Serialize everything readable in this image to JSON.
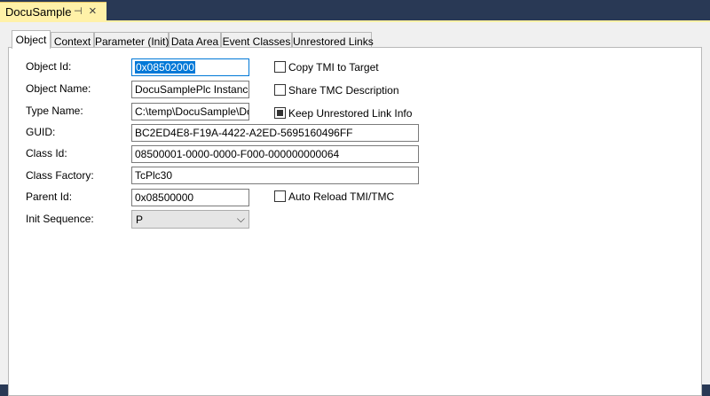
{
  "document_tab": {
    "title": "DocuSample",
    "pin_glyph": "⊣",
    "close_glyph": "×"
  },
  "tabs": [
    {
      "label": "Object",
      "active": true
    },
    {
      "label": "Context",
      "active": false
    },
    {
      "label": "Parameter (Init)",
      "active": false
    },
    {
      "label": "Data Area",
      "active": false
    },
    {
      "label": "Event Classes",
      "active": false
    },
    {
      "label": "Unrestored Links",
      "active": false
    }
  ],
  "form": {
    "object_id": {
      "label": "Object Id:",
      "value": "0x08502000"
    },
    "object_name": {
      "label": "Object Name:",
      "value": "DocuSamplePlc Instance"
    },
    "type_name": {
      "label": "Type Name:",
      "value": "C:\\temp\\DocuSample\\Docu"
    },
    "guid": {
      "label": "GUID:",
      "value": "BC2ED4E8-F19A-4422-A2ED-5695160496FF"
    },
    "class_id": {
      "label": "Class Id:",
      "value": "08500001-0000-0000-F000-000000000064"
    },
    "class_factory": {
      "label": "Class Factory:",
      "value": "TcPlc30"
    },
    "parent_id": {
      "label": "Parent Id:",
      "value": "0x08500000"
    },
    "init_sequence": {
      "label": "Init Sequence:",
      "value": "P",
      "arrow": "⌵"
    }
  },
  "checkboxes": {
    "copy_tmi": {
      "label": "Copy TMI to Target",
      "checked": false
    },
    "share_tmc": {
      "label": "Share TMC Description",
      "checked": false
    },
    "keep_unrestored": {
      "label": "Keep Unrestored Link Info",
      "checked": true
    },
    "auto_reload": {
      "label": "Auto Reload TMI/TMC",
      "checked": false
    }
  },
  "colors": {
    "background": "#293955",
    "doc_tab": "#fff1a8",
    "selection": "#0078d7"
  }
}
